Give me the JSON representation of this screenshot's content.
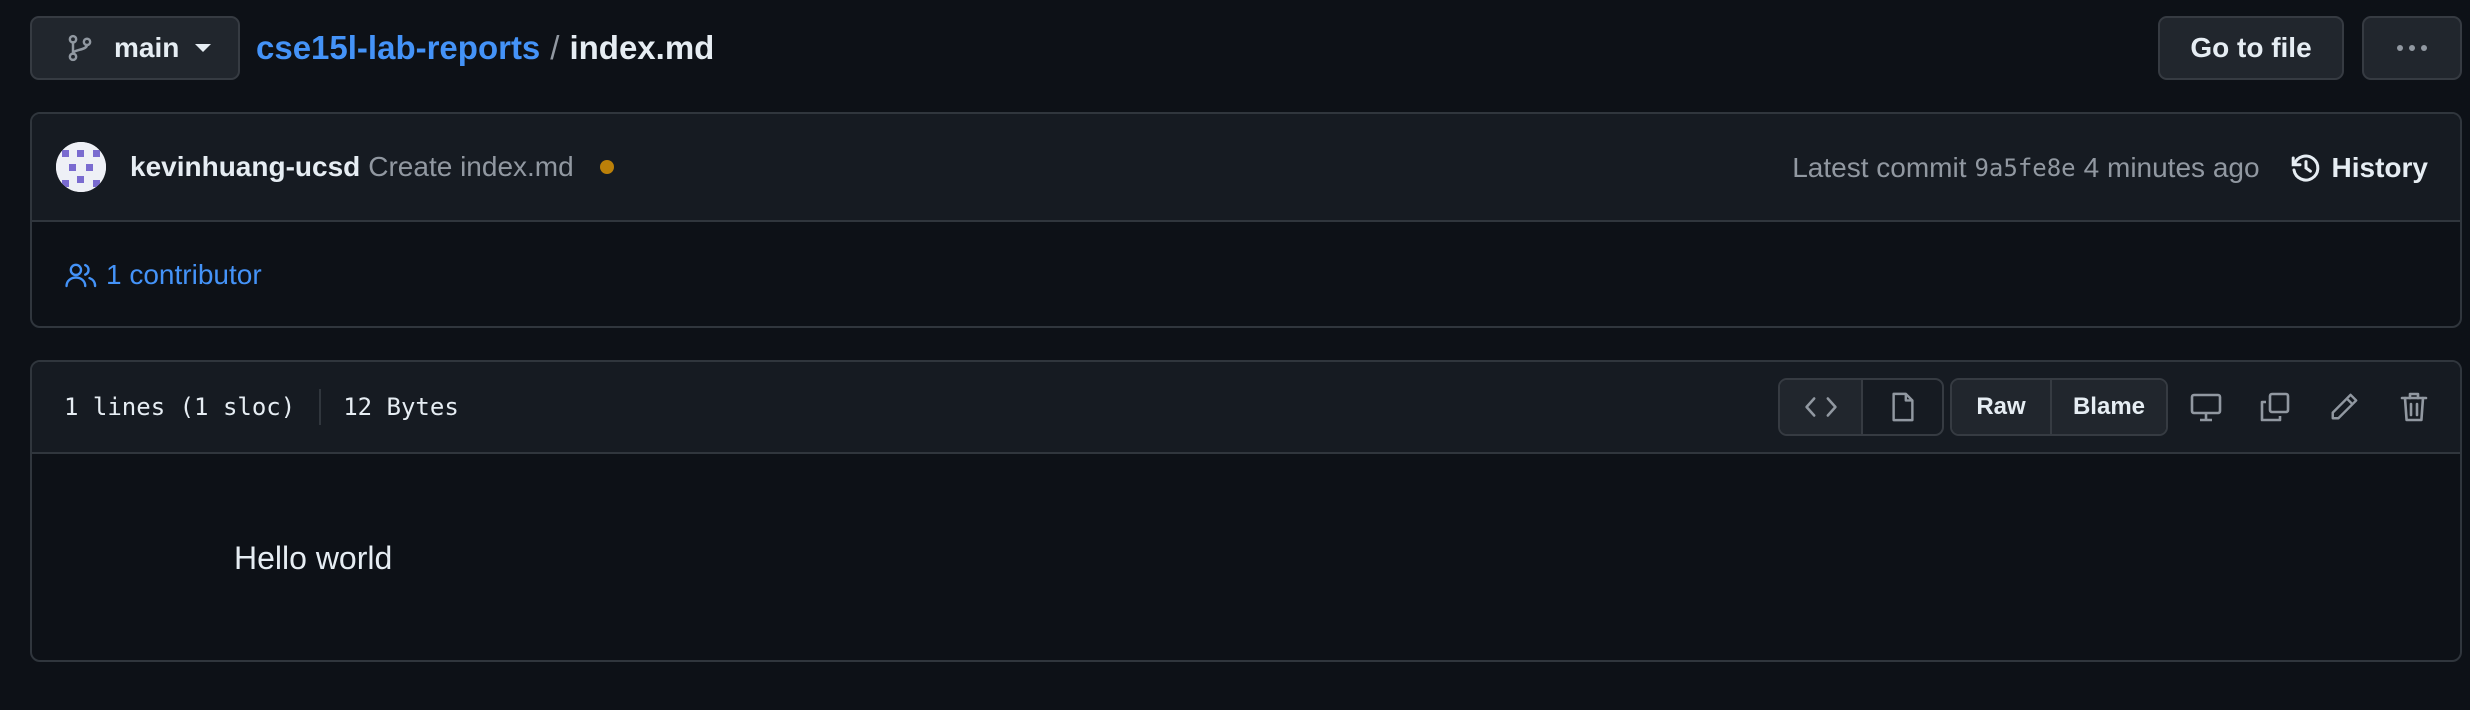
{
  "topbar": {
    "branch_label": "main",
    "repo_name": "cse15l-lab-reports",
    "separator": "/",
    "file_name": "index.md",
    "goto_label": "Go to file"
  },
  "commit": {
    "author": "kevinhuang-ucsd",
    "message": "Create index.md",
    "status_color": "#bb8009",
    "latest_label": "Latest commit",
    "sha": "9a5fe8e",
    "time": "4 minutes ago",
    "history_label": "History"
  },
  "contributors": {
    "label": "1 contributor"
  },
  "file": {
    "lines": "1 lines (1 sloc)",
    "size": "12 Bytes",
    "raw_label": "Raw",
    "blame_label": "Blame",
    "content": "Hello world"
  },
  "icons": {
    "branch": "git-branch-icon",
    "more": "kebab-horizontal-icon",
    "history": "history-icon",
    "contributors": "people-icon",
    "code": "code-icon",
    "file": "file-icon",
    "display": "desktop-icon",
    "copy": "copy-icon",
    "edit": "pencil-icon",
    "delete": "trash-icon"
  },
  "colors": {
    "background": "#0d1117",
    "panel": "#161b22",
    "link": "#4493f8",
    "muted": "#9198a1",
    "border": "#30363d"
  }
}
